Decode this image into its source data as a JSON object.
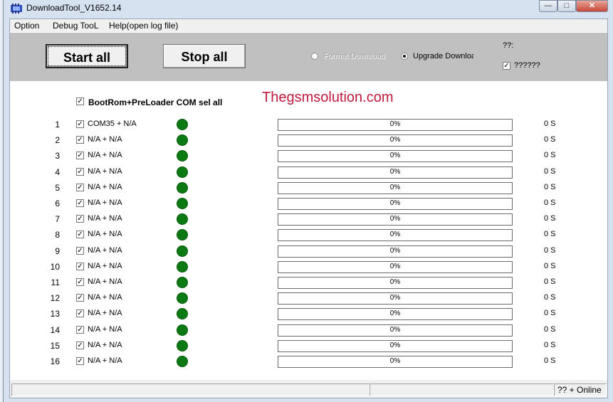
{
  "window": {
    "title": "DownloadTool_V1652.14",
    "minimize_glyph": "—",
    "maximize_glyph": "□",
    "close_glyph": "✕"
  },
  "menu": [
    "Option",
    "Debug TooL",
    "Help(open log file)"
  ],
  "toolbar": {
    "start_label": "Start all",
    "stop_label": "Stop all",
    "format_label": "Format Download",
    "upgrade_label": "Upgrade Download",
    "selected_mode": "Upgrade Download",
    "question_label": "??:",
    "extra_checkbox_label": "??????",
    "extra_checked": true
  },
  "main": {
    "select_all_label": "BootRom+PreLoader COM sel all",
    "select_all_checked": true,
    "watermark": "Thegsmsolution.com"
  },
  "colors": {
    "led": "#0c7a12",
    "watermark": "#c0193d",
    "toolbar_bg": "#c0c0c0"
  },
  "rows": [
    {
      "num": "1",
      "port": "COM35 + N/A",
      "progress": "0%",
      "time": "0 S",
      "checked": true
    },
    {
      "num": "2",
      "port": "N/A + N/A",
      "progress": "0%",
      "time": "0 S",
      "checked": true
    },
    {
      "num": "3",
      "port": "N/A + N/A",
      "progress": "0%",
      "time": "0 S",
      "checked": true
    },
    {
      "num": "4",
      "port": "N/A + N/A",
      "progress": "0%",
      "time": "0 S",
      "checked": true
    },
    {
      "num": "5",
      "port": "N/A + N/A",
      "progress": "0%",
      "time": "0 S",
      "checked": true
    },
    {
      "num": "6",
      "port": "N/A + N/A",
      "progress": "0%",
      "time": "0 S",
      "checked": true
    },
    {
      "num": "7",
      "port": "N/A + N/A",
      "progress": "0%",
      "time": "0 S",
      "checked": true
    },
    {
      "num": "8",
      "port": "N/A + N/A",
      "progress": "0%",
      "time": "0 S",
      "checked": true
    },
    {
      "num": "9",
      "port": "N/A + N/A",
      "progress": "0%",
      "time": "0 S",
      "checked": true
    },
    {
      "num": "10",
      "port": "N/A + N/A",
      "progress": "0%",
      "time": "0 S",
      "checked": true
    },
    {
      "num": "11",
      "port": "N/A + N/A",
      "progress": "0%",
      "time": "0 S",
      "checked": true
    },
    {
      "num": "12",
      "port": "N/A + N/A",
      "progress": "0%",
      "time": "0 S",
      "checked": true
    },
    {
      "num": "13",
      "port": "N/A + N/A",
      "progress": "0%",
      "time": "0 S",
      "checked": true
    },
    {
      "num": "14",
      "port": "N/A + N/A",
      "progress": "0%",
      "time": "0 S",
      "checked": true
    },
    {
      "num": "15",
      "port": "N/A + N/A",
      "progress": "0%",
      "time": "0 S",
      "checked": true
    },
    {
      "num": "16",
      "port": "N/A + N/A",
      "progress": "0%",
      "time": "0 S",
      "checked": true
    }
  ],
  "statusbar": {
    "pane1": "",
    "pane2": "",
    "pane3": "?? + Online"
  }
}
